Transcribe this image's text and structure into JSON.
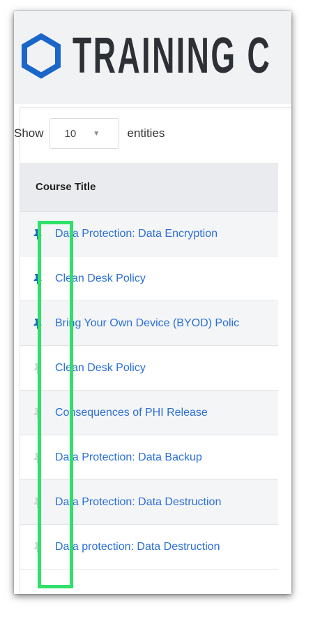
{
  "header": {
    "brand_title": "TRAINING C",
    "brand_color": "#1a66c9"
  },
  "show_entries": {
    "show_label": "Show",
    "selected_value": "10",
    "entities_label": "entities"
  },
  "table": {
    "column_header": "Course Title",
    "rows": [
      {
        "title": "Data Protection: Data Encryption",
        "pinned": true
      },
      {
        "title": "Clean Desk Policy",
        "pinned": true
      },
      {
        "title": "Bring Your Own Device (BYOD) Polic",
        "pinned": true
      },
      {
        "title": "Clean Desk Policy",
        "pinned": false
      },
      {
        "title": "Consequences of PHI Release",
        "pinned": false
      },
      {
        "title": "Data Protection: Data Backup",
        "pinned": false
      },
      {
        "title": "Data Protection: Data Destruction",
        "pinned": false
      },
      {
        "title": "Data protection: Data Destruction",
        "pinned": false
      }
    ],
    "pin_icon": "pushpin-icon",
    "pinned_color": "#1a66c9",
    "unpinned_color": "#d3d5d9",
    "link_color": "#2a6fd6"
  },
  "highlight_color": "#2fe06a"
}
